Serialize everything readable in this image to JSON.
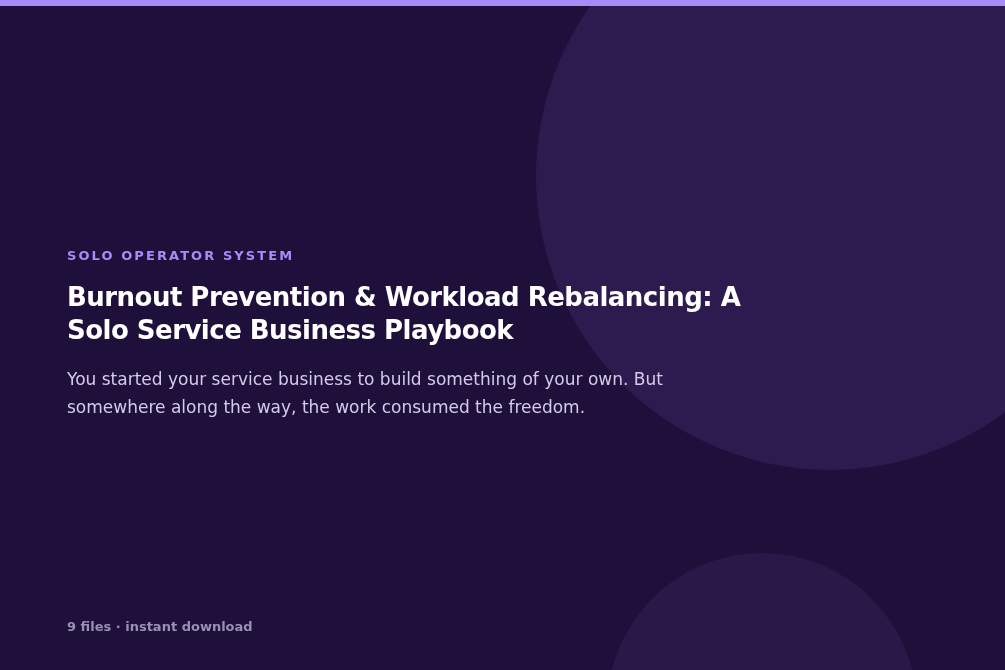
{
  "eyebrow": "SOLO OPERATOR SYSTEM",
  "title": "Burnout Prevention & Workload Rebalancing: A Solo Service Business Playbook",
  "description": "You started your service business to build something of your own. But somewhere along the way, the work consumed the freedom.",
  "footer": "9 files · instant download"
}
